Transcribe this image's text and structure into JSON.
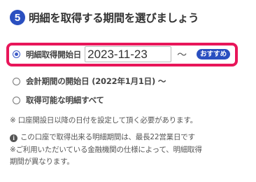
{
  "colors": {
    "accent": "#2a4fc0",
    "highlight_border": "#e8165a",
    "badge_bg": "#2a4fc0"
  },
  "heading": {
    "step_number": "5",
    "title": "明細を取得する期間を選びましょう"
  },
  "options": [
    {
      "label": "明細取得開始日",
      "selected": true,
      "date_value": "2023-11-23",
      "suffix": "～",
      "badge": "おすすめ"
    },
    {
      "label": "会計期間の開始日 (2022年1月1日) ～",
      "selected": false
    },
    {
      "label": "取得可能な明細すべて",
      "selected": false
    }
  ],
  "notes": {
    "date_note": "※ 口座開設日以降の日付を設定して頂く必要があります。",
    "info_icon": "info-circle-icon",
    "info_line1": "この口座で取得出来る明細期間は、最長22営業日です",
    "info_line2": "※ご利用いただいている金融機関の仕様によって、明細取得",
    "info_line3": "期間が異なります。"
  }
}
